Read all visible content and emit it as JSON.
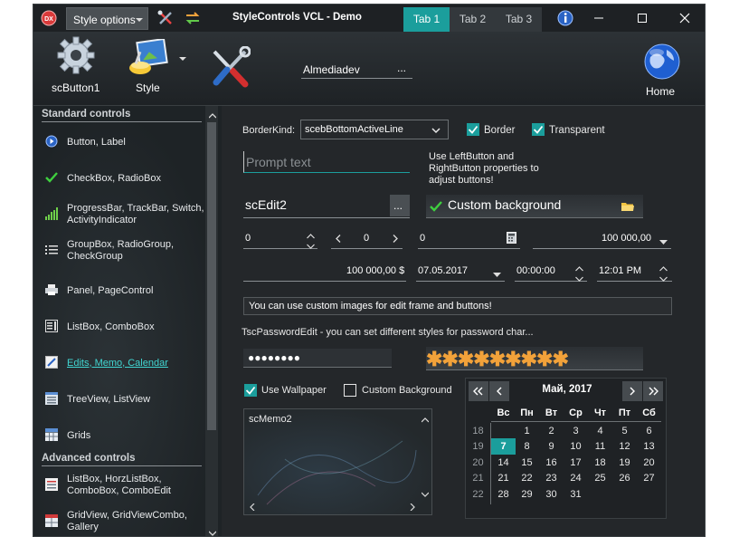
{
  "titlebar": {
    "style_options_label": "Style options",
    "app_title": "StyleControls VCL - Demo",
    "tabs": [
      "Tab 1",
      "Tab 2",
      "Tab 3"
    ],
    "active_tab": 0
  },
  "ribbon": {
    "button1_label": "scButton1",
    "style_label": "Style",
    "edit_value": "Almediadev",
    "edit_button_label": "...",
    "home_label": "Home"
  },
  "sidebar": {
    "standard_header": "Standard controls",
    "advanced_header": "Advanced controls",
    "standard_items": [
      {
        "label": "Button, Label",
        "icon": "info-icon"
      },
      {
        "label": "CheckBox, RadioBox",
        "icon": "check-icon"
      },
      {
        "label": "ProgressBar, TrackBar, Switch, ActivityIndicator",
        "icon": "bars-icon"
      },
      {
        "label": "GroupBox, RadioGroup, CheckGroup",
        "icon": "list-icon"
      },
      {
        "label": "Panel, PageControl",
        "icon": "printer-icon"
      },
      {
        "label": "ListBox, ComboBox",
        "icon": "listbox-icon"
      },
      {
        "label": "Edits, Memo, Calendar",
        "icon": "edit-icon"
      },
      {
        "label": "TreeView, ListView",
        "icon": "treeview-icon"
      },
      {
        "label": "Grids",
        "icon": "grid-icon"
      }
    ],
    "advanced_items": [
      {
        "label": "ListBox, HorzListBox, ComboBox, ComboEdit",
        "icon": "listbox-icon"
      },
      {
        "label": "GridView, GridViewCombo, Gallery",
        "icon": "gridview-icon"
      }
    ],
    "selected_index": 6
  },
  "content": {
    "borderkind_label": "BorderKind:",
    "borderkind_value": "scebBottomActiveLine",
    "border_label": "Border",
    "transparent_label": "Transparent",
    "prompt_placeholder": "Prompt text",
    "hint_text": "Use LeftButton and RightButton properties to adjust buttons!",
    "scedit2_value": "scEdit2",
    "scedit2_button": "...",
    "custom_bg_value": "Custom background",
    "spin1_value": "0",
    "spin2_value": "0",
    "calc_value": "0",
    "currency_combo_value": "100 000,00",
    "money_value": "100 000,00 $",
    "date_value": "07.05.2017",
    "time1_value": "00:00:00",
    "time2_value": "12:01 PM",
    "custom_images_text": "You can use custom images for edit frame and buttons!",
    "password_caption": "TscPasswordEdit - you can set different styles for password char...",
    "password1_mask": "●●●●●●●●",
    "password2_mask": "✱✱✱✱✱✱✱✱✱",
    "use_wallpaper_label": "Use Wallpaper",
    "custom_background_label": "Custom Background",
    "memo_text": "scMemo2"
  },
  "calendar": {
    "month_title": "Май, 2017",
    "weekdays": [
      "Вс",
      "Пн",
      "Вт",
      "Ср",
      "Чт",
      "Пт",
      "Сб"
    ],
    "weeks": [
      {
        "week": "18",
        "days": [
          "",
          "1",
          "2",
          "3",
          "4",
          "5",
          "6"
        ]
      },
      {
        "week": "19",
        "days": [
          "7",
          "8",
          "9",
          "10",
          "11",
          "12",
          "13"
        ]
      },
      {
        "week": "20",
        "days": [
          "14",
          "15",
          "16",
          "17",
          "18",
          "19",
          "20"
        ]
      },
      {
        "week": "21",
        "days": [
          "21",
          "22",
          "23",
          "24",
          "25",
          "26",
          "27"
        ]
      },
      {
        "week": "22",
        "days": [
          "28",
          "29",
          "30",
          "31",
          "",
          "",
          ""
        ]
      }
    ],
    "today": "7"
  },
  "colors": {
    "accent": "#1b9e9c",
    "background": "#24272a",
    "selected_nav": "#41d6d2"
  }
}
